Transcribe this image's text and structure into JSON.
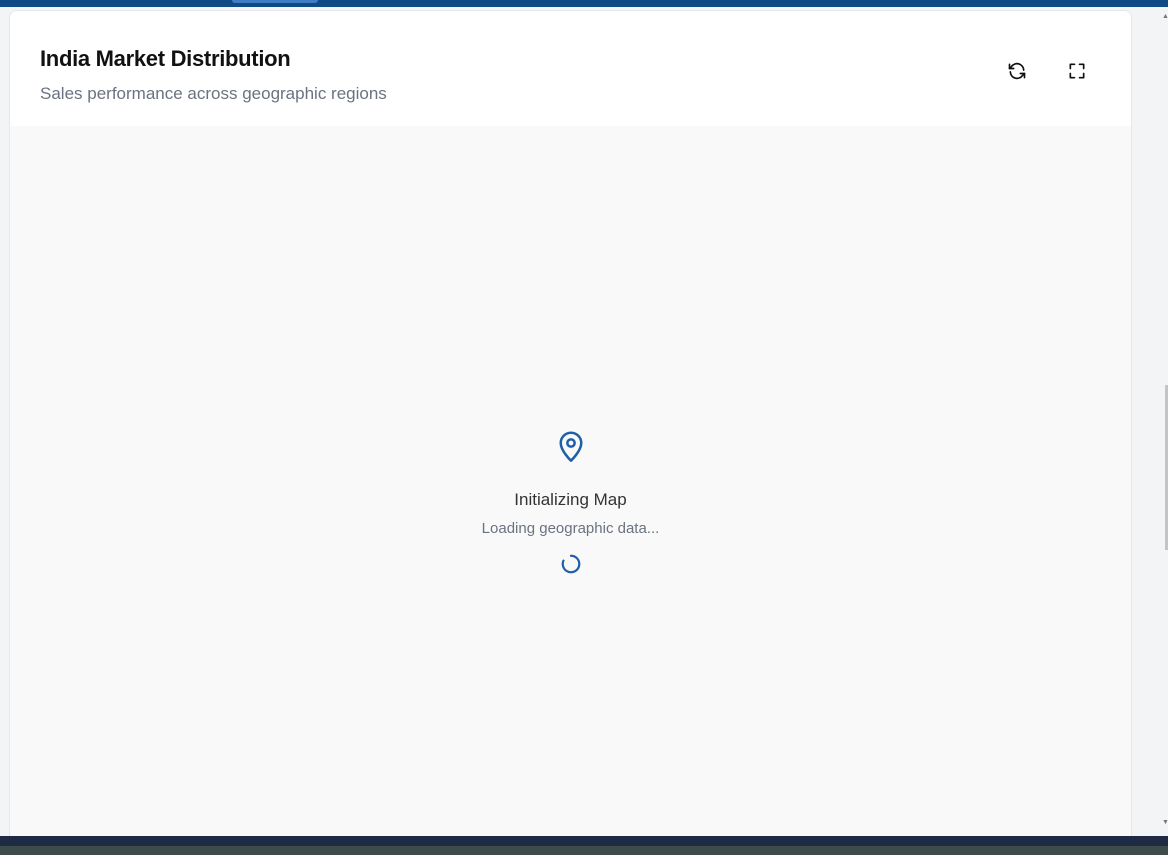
{
  "card": {
    "title": "India Market Distribution",
    "subtitle": "Sales performance across geographic regions",
    "actions": [
      {
        "name": "refresh",
        "icon": "refresh-icon"
      },
      {
        "name": "fullscreen",
        "icon": "fullscreen-icon"
      }
    ]
  },
  "map": {
    "status_icon": "map-pin-icon",
    "loading_title": "Initializing Map",
    "loading_subtitle": "Loading geographic data..."
  },
  "colors": {
    "accent": "#1e5fa8",
    "top_strip": "#0f4a87",
    "map_background": "#f9f9f9"
  }
}
